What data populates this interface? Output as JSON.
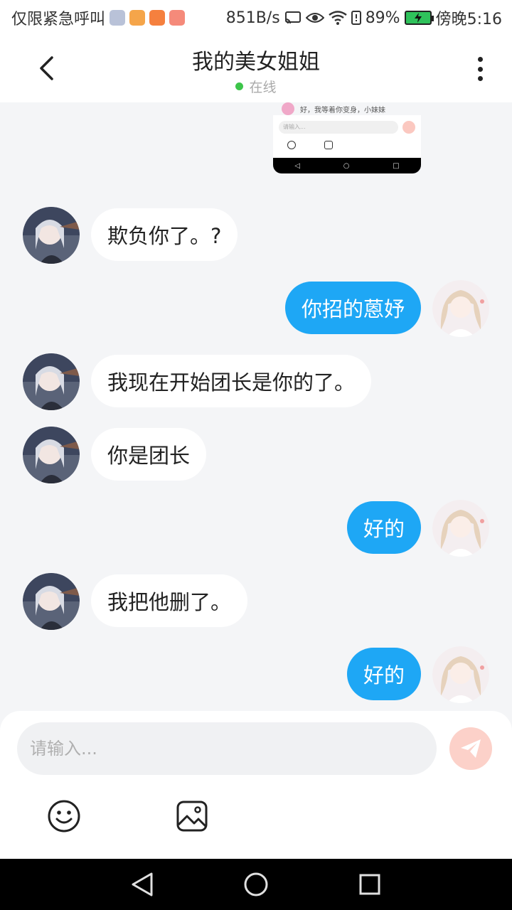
{
  "status_bar": {
    "carrier": "仅限紧急呼叫",
    "speed": "851B/s",
    "battery": "89%",
    "time": "傍晚5:16",
    "app_icon_colors": [
      "#b9c2d8",
      "#f5a54a",
      "#f5803e",
      "#f58a7a"
    ]
  },
  "header": {
    "title": "我的美女姐姐",
    "status": "在线"
  },
  "thumbnail": {
    "message": "好，我等着你变身，小妹妹",
    "input_placeholder": "请输入..."
  },
  "messages": [
    {
      "side": "left",
      "text": "欺负你了。?"
    },
    {
      "side": "right",
      "text": "你招的蒽妤"
    },
    {
      "side": "left",
      "text": "我现在开始团长是你的了。"
    },
    {
      "side": "left",
      "text": "你是团长"
    },
    {
      "side": "right",
      "text": "好的"
    },
    {
      "side": "left",
      "text": "我把他删了。"
    },
    {
      "side": "right",
      "text": "好的"
    }
  ],
  "input": {
    "placeholder": "请输入..."
  },
  "colors": {
    "accent": "#1ea7f5",
    "send_button": "#fcd1c9",
    "online": "#3dc54a"
  }
}
